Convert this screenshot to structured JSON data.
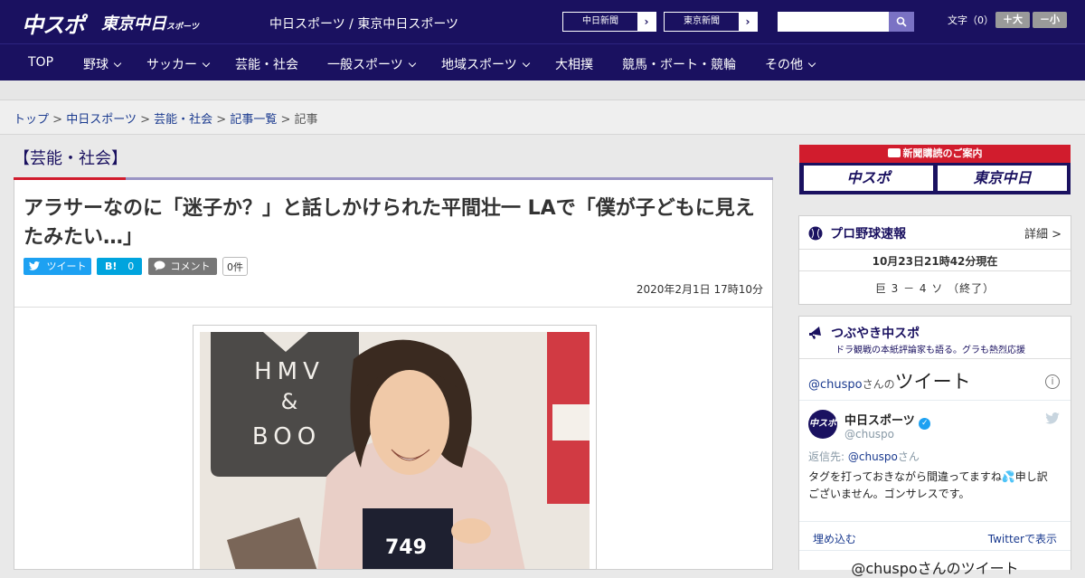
{
  "header": {
    "logo_chuspo": "中スポ",
    "logo_tokyo": "東京中日",
    "logo_tokyo_sub": "スポーツ",
    "site_title": "中日スポーツ / 東京中日スポーツ",
    "links": [
      "中日新聞",
      "東京新聞"
    ],
    "search_placeholder": "",
    "text_size_label": "文字（0）",
    "size_up": "＋大",
    "size_down": "－小"
  },
  "nav": {
    "items": [
      {
        "label": "TOP",
        "dropdown": false
      },
      {
        "label": "野球",
        "dropdown": true
      },
      {
        "label": "サッカー",
        "dropdown": true
      },
      {
        "label": "芸能・社会",
        "dropdown": false
      },
      {
        "label": "一般スポーツ",
        "dropdown": true
      },
      {
        "label": "地域スポーツ",
        "dropdown": true
      },
      {
        "label": "大相撲",
        "dropdown": false
      },
      {
        "label": "競馬・ボート・競輪",
        "dropdown": false
      },
      {
        "label": "その他",
        "dropdown": true
      }
    ]
  },
  "breadcrumb": {
    "items": [
      "トップ",
      "中日スポーツ",
      "芸能・社会",
      "記事一覧"
    ],
    "current": "記事",
    "separator": ">"
  },
  "article": {
    "category": "【芸能・社会】",
    "title": "アラサーなのに「迷子か？」と話しかけられた平間壮一 LAで「僕が子どもに見えたみたい…」",
    "tweet_label": "ツイート",
    "hatena_label": "B!",
    "hatena_count": "0",
    "comment_label": "コメント",
    "comment_count": "0件",
    "date": "2020年2月1日 17時10分",
    "photo_sign_lines": [
      "HMV",
      "&",
      "BOO"
    ],
    "photo_book_number": "749"
  },
  "sidebar": {
    "ad_title": "新聞購読のご案内",
    "ad_buttons": [
      "中スポ",
      "東京中日"
    ],
    "baseball": {
      "title": "プロ野球速報",
      "detail": "詳細 >",
      "time": "10月23日21時42分現在",
      "score": "巨 3 － 4 ソ （終了）"
    },
    "tweets": {
      "title": "つぶやき中スポ",
      "subtitle": "ドラ観戦の本紙評論家も語る。グラも熱烈応援",
      "handle_line_handle": "@chuspo",
      "handle_line_suffix": "さんの",
      "handle_line_big": "ツイート",
      "account_name": "中日スポーツ",
      "account_handle": "@chuspo",
      "reply_to_label": "返信先:",
      "reply_to_handle": "@chuspo",
      "reply_to_suffix": "さん",
      "body_line1": "タグを打っておきながら間違ってますね",
      "body_line1_end": "申し訳",
      "body_line2": "ございません。ゴンサレスです。",
      "embed": "埋め込む",
      "view_on_twitter": "Twitterで表示",
      "footer_handle": "@chuspo",
      "footer_suffix": "さんのツイート"
    }
  },
  "colors": {
    "navy": "#1a1160",
    "accent_red": "#d11c2d",
    "twitter_blue": "#1da1f2",
    "hatena_blue": "#00a4de",
    "comment_gray": "#777777"
  }
}
